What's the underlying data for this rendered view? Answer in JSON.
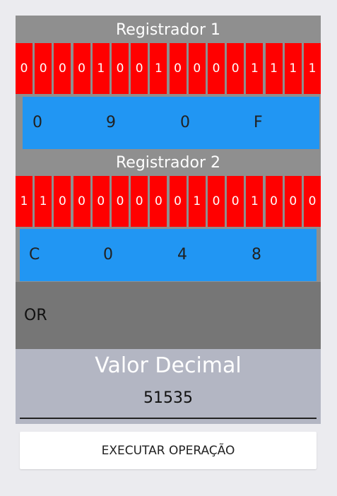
{
  "register1": {
    "title": "Registrador 1",
    "bits": [
      "0",
      "0",
      "0",
      "0",
      "1",
      "0",
      "0",
      "1",
      "0",
      "0",
      "0",
      "0",
      "1",
      "1",
      "1",
      "1"
    ],
    "hex": [
      "0",
      "9",
      "0",
      "F"
    ]
  },
  "register2": {
    "title": "Registrador 2",
    "bits": [
      "1",
      "1",
      "0",
      "0",
      "0",
      "0",
      "0",
      "0",
      "0",
      "1",
      "0",
      "0",
      "1",
      "0",
      "0",
      "0"
    ],
    "hex": [
      "C",
      "0",
      "4",
      "8"
    ]
  },
  "operation": {
    "label": "OR"
  },
  "result": {
    "title": "Valor Decimal",
    "value": "51535"
  },
  "action": {
    "label": "EXECUTAR OPERAÇÃO"
  },
  "colors": {
    "bit_background": "#ff0000",
    "hex_background": "#2196f3",
    "panel_background": "#8f8f8f",
    "operation_background": "#767676",
    "result_background": "#b3b6c3"
  }
}
